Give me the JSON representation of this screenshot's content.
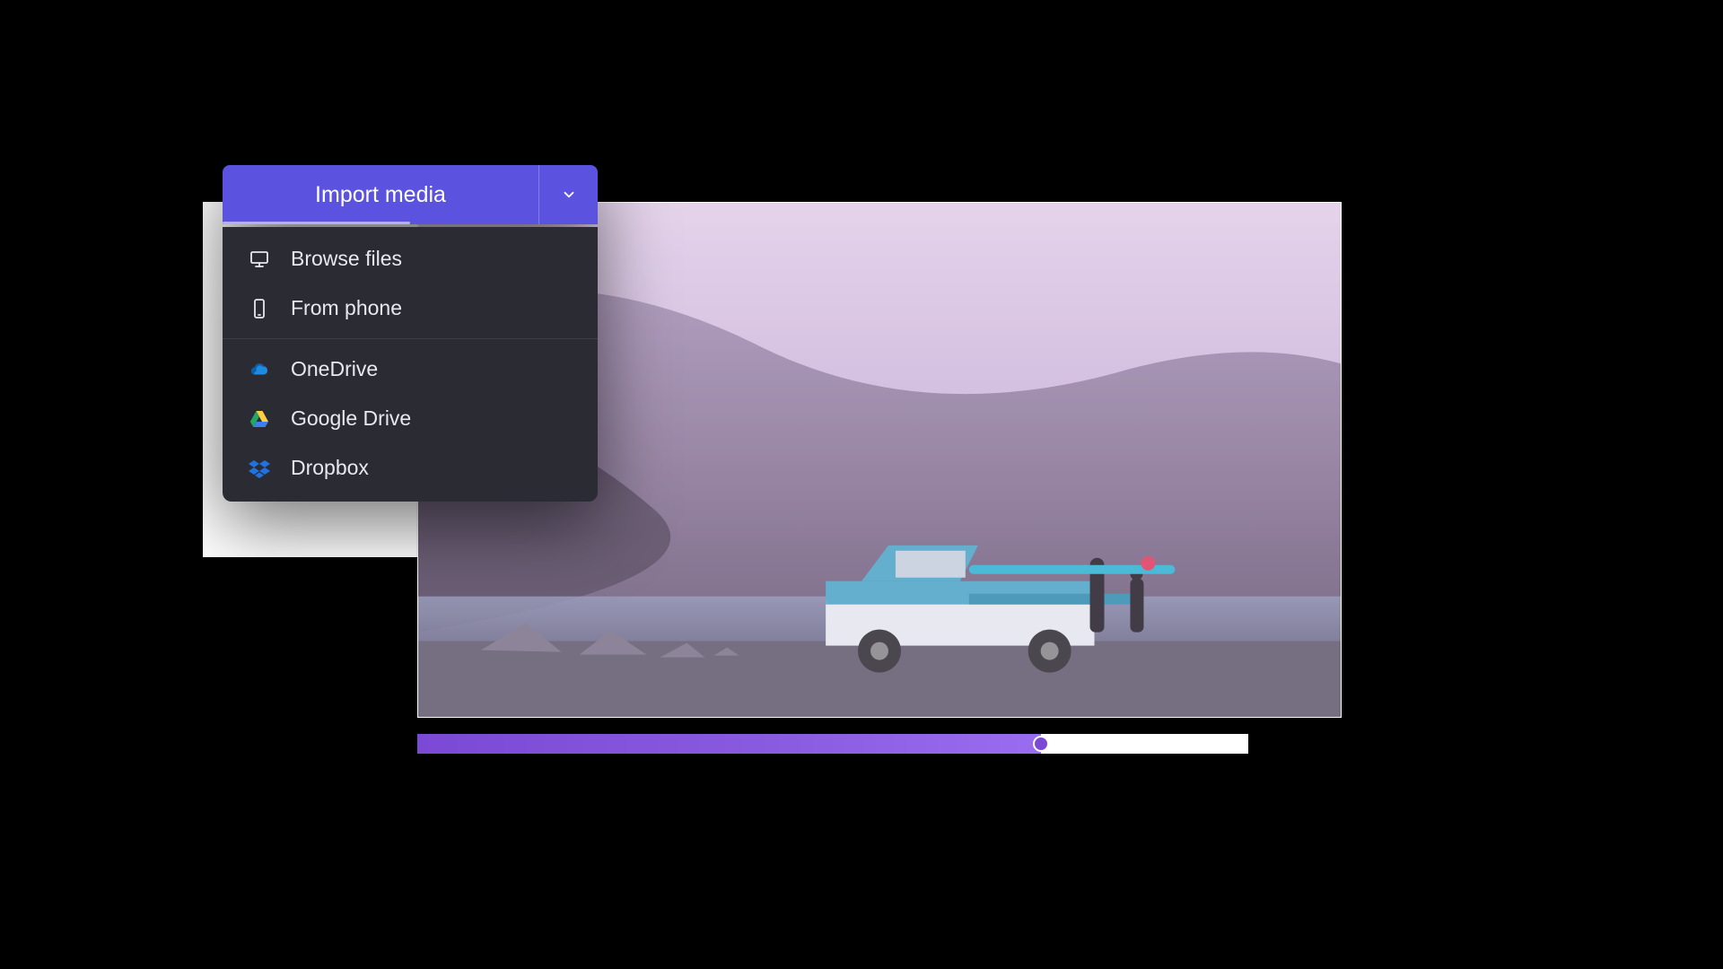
{
  "import": {
    "button_label": "Import media"
  },
  "menu": {
    "browse_files": "Browse files",
    "from_phone": "From phone",
    "onedrive": "OneDrive",
    "google_drive": "Google Drive",
    "dropbox": "Dropbox"
  },
  "timeline": {
    "progress_percent": 75
  },
  "colors": {
    "accent": "#5b53e0",
    "timeline_gradient_start": "#7b49d5",
    "timeline_gradient_end": "#9a6df0",
    "dropdown_bg": "#2b2b34"
  }
}
